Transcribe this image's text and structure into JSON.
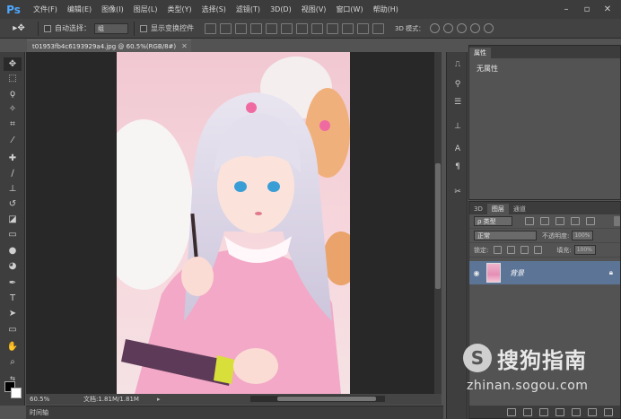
{
  "app": {
    "logo": "Ps"
  },
  "menu": [
    "文件(F)",
    "编辑(E)",
    "图像(I)",
    "图层(L)",
    "类型(Y)",
    "选择(S)",
    "滤镜(T)",
    "3D(D)",
    "视图(V)",
    "窗口(W)",
    "帮助(H)"
  ],
  "window_controls": [
    "minimize-icon",
    "maximize-icon",
    "close-icon"
  ],
  "options": {
    "auto_select_label": "自动选择：",
    "auto_select_value": "组",
    "show_transform_label": "显示变换控件",
    "mode_3d_label": "3D 模式："
  },
  "document": {
    "tab_title": "t01953fb4c6193929a4.jpg @ 60.5%(RGB/8#)",
    "zoom": "60.5%",
    "doc_info": "文档:1.81M/1.81M"
  },
  "timeline_label": "时间轴",
  "properties": {
    "tab": "属性",
    "body": "无属性"
  },
  "layers_panel": {
    "tabs": [
      "3D",
      "图层",
      "通道"
    ],
    "kind_filter": "ρ 类型",
    "blend_mode": "正常",
    "opacity_label": "不透明度:",
    "opacity_value": "100%",
    "lock_label": "锁定:",
    "fill_label": "填充:",
    "fill_value": "100%",
    "layers": [
      {
        "name": "背景",
        "visible": true,
        "locked": true
      }
    ]
  },
  "watermark": {
    "brand": "搜狗指南",
    "url": "zhinan.sogou.com"
  },
  "colors": {
    "accent": "#4ea8ff",
    "selected_layer": "#5c7597",
    "foreground": "#000000",
    "background": "#ffffff"
  }
}
